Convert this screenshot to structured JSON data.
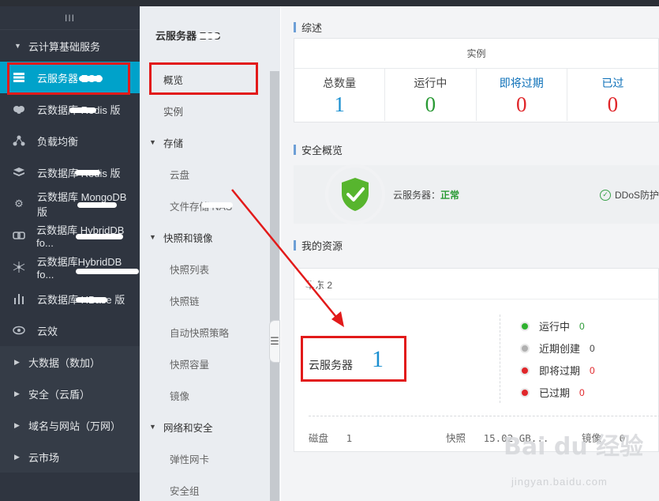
{
  "colors": {
    "sidebar_bg": "#2f3540",
    "active_bg": "#00a2ca",
    "annotation_red": "#e21a1a",
    "green": "#2a9a35",
    "red_num": "#e0262a",
    "blue_num": "#1a8fd0"
  },
  "sidebar": {
    "collapse_glyph": "III",
    "group_main": "云计算基础服务",
    "items": [
      {
        "label": "云服务器 ECS",
        "icon": "server-icon"
      },
      {
        "label": "云数据库 Redis 版",
        "icon": "database-icon"
      },
      {
        "label": "负载均衡",
        "icon": "load-balancer-icon"
      },
      {
        "label": "云数据库 Redis 版",
        "icon": "stack-icon"
      },
      {
        "label": "云数据库 MongoDB 版",
        "icon": "gear-icon"
      },
      {
        "label": "云数据库 HybridDB fo...",
        "icon": "link-icon"
      },
      {
        "label": "云数据库HybridDB fo...",
        "icon": "network-icon"
      },
      {
        "label": "云数据库 HBase 版",
        "icon": "chart-bars-icon"
      },
      {
        "label": "云效",
        "icon": "eye-icon"
      }
    ],
    "lower_groups": [
      "大数据（数加）",
      "安全（云盾）",
      "域名与网站（万网）",
      "云市场"
    ]
  },
  "submenu": {
    "title": "云服务器 ECS",
    "overview": "概览",
    "instances": "实例",
    "storage_group": "存储",
    "storage_items": [
      "云盘",
      "文件存储 NAS"
    ],
    "snapshot_group": "快照和镜像",
    "snapshot_items": [
      "快照列表",
      "快照链",
      "自动快照策略",
      "快照容量",
      "镜像"
    ],
    "network_group": "网络和安全",
    "network_items": [
      "弹性网卡",
      "安全组"
    ]
  },
  "overview": {
    "title": "综述",
    "instance_header": "实例",
    "stats": [
      {
        "label": "总数量",
        "value": "1"
      },
      {
        "label": "运行中",
        "value": "0"
      },
      {
        "label": "即将过期",
        "value": "0"
      },
      {
        "label": "已过",
        "value": "0"
      }
    ]
  },
  "security": {
    "title": "安全概览",
    "ecs_label": "云服务器：",
    "ecs_status": "正常",
    "ddos_label": "DDoS防护"
  },
  "resources": {
    "title": "我的资源",
    "region": "华东 2",
    "ecs_label": "云服务器",
    "ecs_count": "1",
    "statuses": [
      {
        "label": "运行中",
        "count": "0",
        "color": "#2fb12f"
      },
      {
        "label": "近期创建",
        "count": "0",
        "color": "#b0b0b0"
      },
      {
        "label": "即将过期",
        "count": "0",
        "color": "#e0262a"
      },
      {
        "label": "已过期",
        "count": "0",
        "color": "#e0262a"
      }
    ],
    "disk_label": "磁盘",
    "disk_count": "1",
    "snapshot_label": "快照",
    "snapshot_value": "15.02 GB...",
    "image_label": "镜像",
    "image_count": "0"
  },
  "watermark": {
    "main": "Bai du 经验",
    "sub": "jingyan.baidu.com"
  }
}
